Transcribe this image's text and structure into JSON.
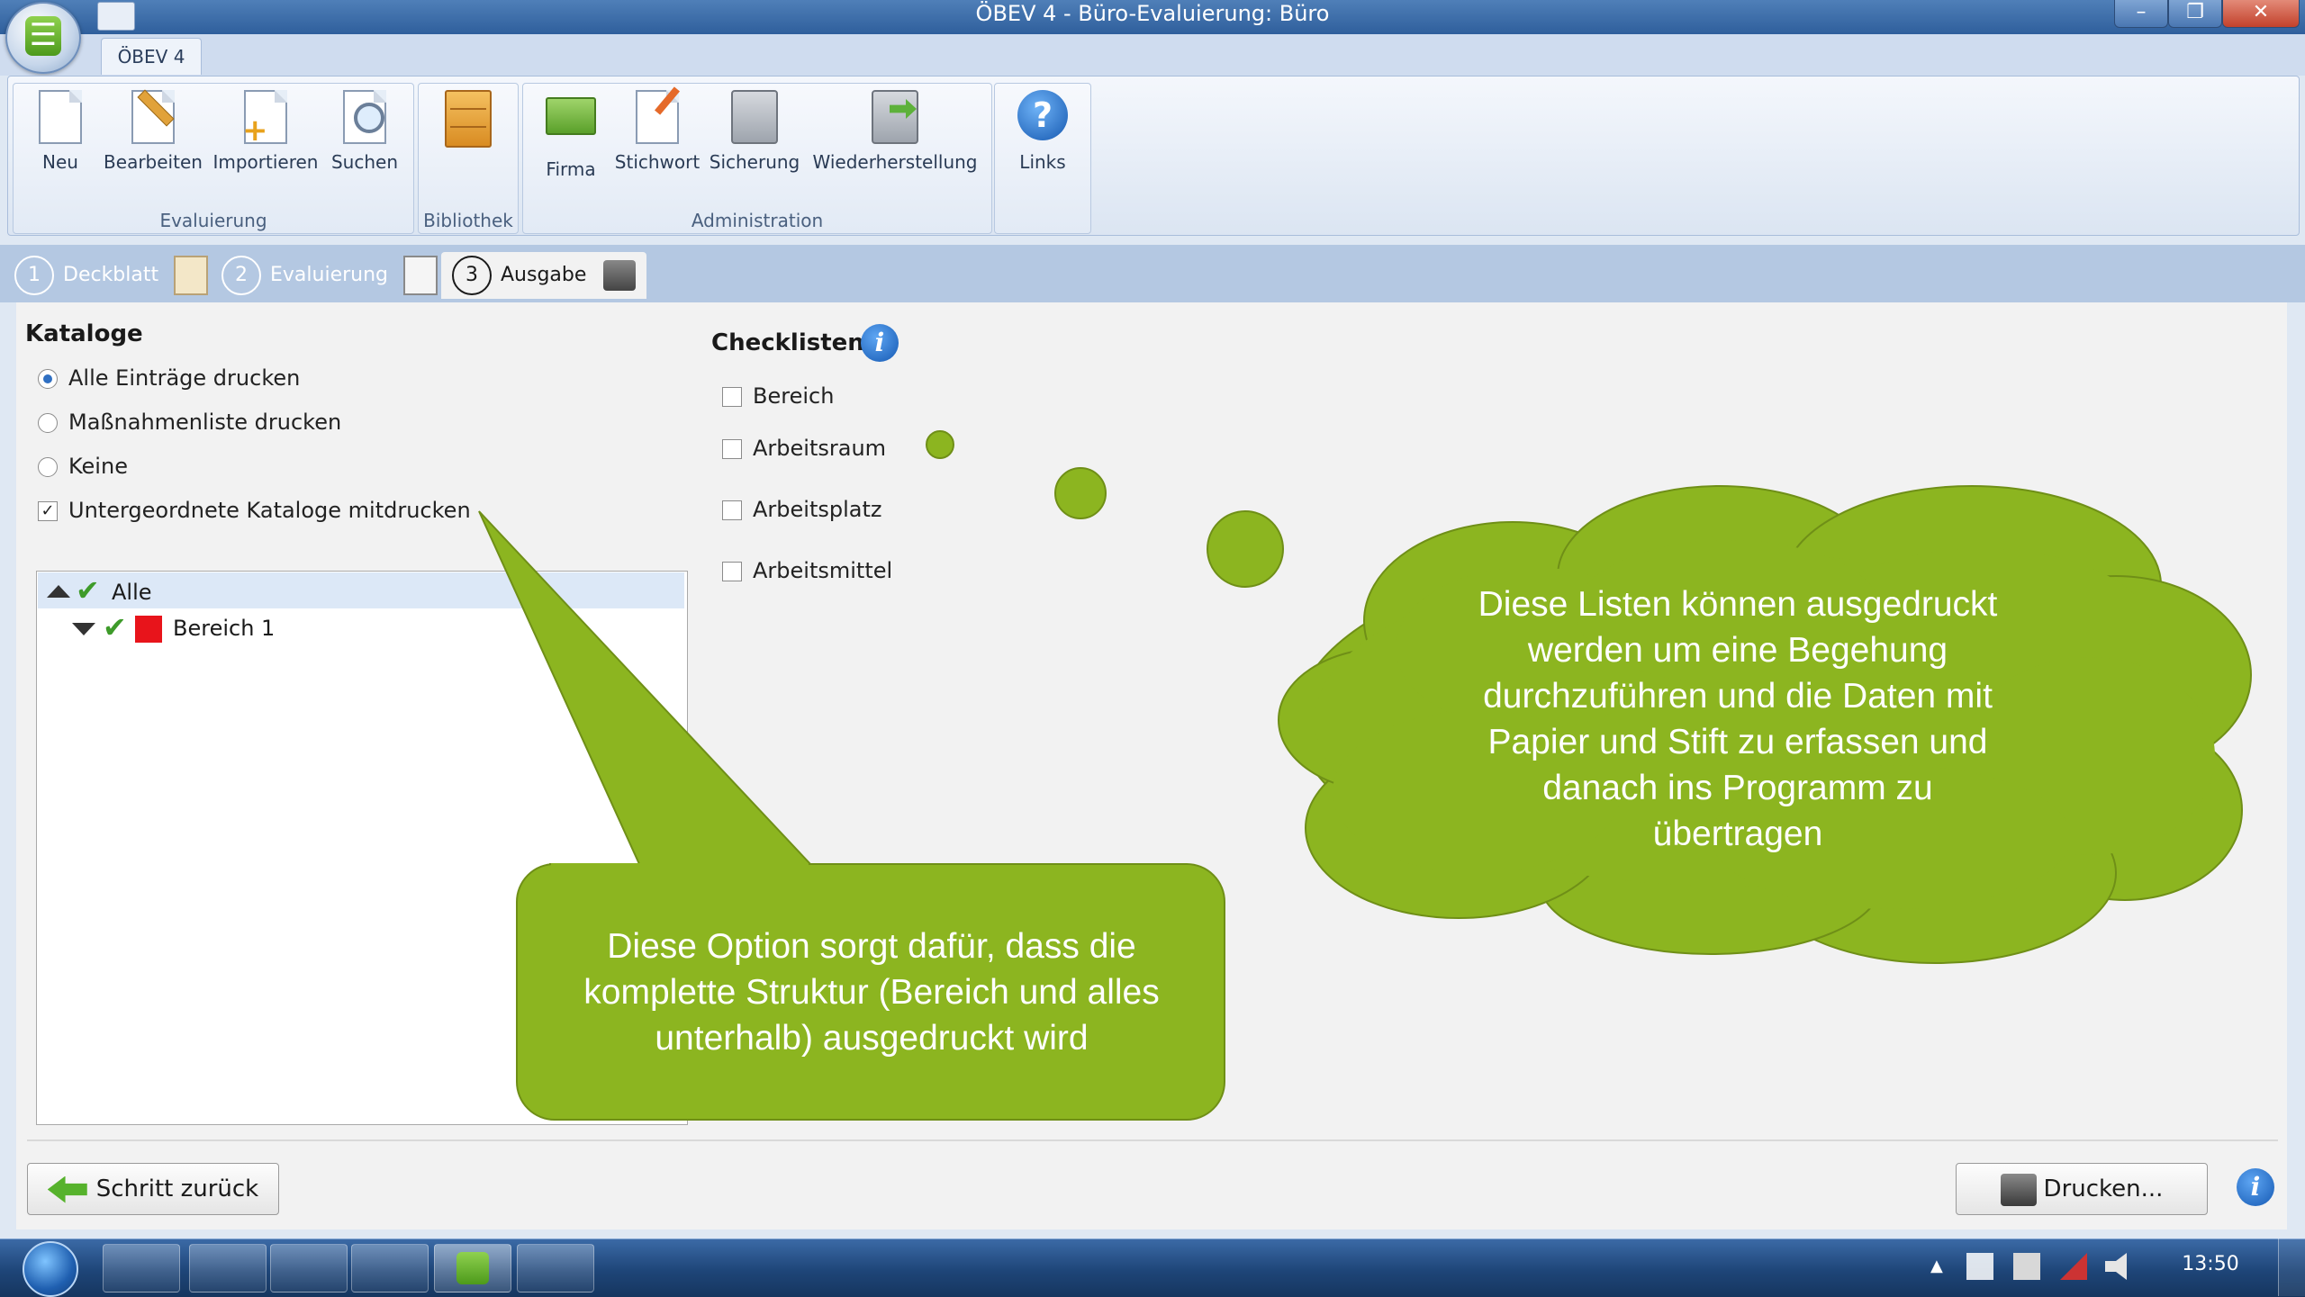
{
  "window": {
    "title": "ÖBEV 4 - Büro-Evaluierung: Büro",
    "minimize_glyph": "–",
    "restore_glyph": "❐",
    "close_glyph": "✕"
  },
  "ribbon": {
    "tab": "ÖBEV 4",
    "groups": {
      "evaluierung": "Evaluierung",
      "bibliothek": "Bibliothek",
      "administration": "Administration"
    },
    "buttons": {
      "neu": "Neu",
      "bearbeiten": "Bearbeiten",
      "importieren": "Importieren",
      "suchen": "Suchen",
      "firma": "Firma",
      "stichwort": "Stichwort",
      "sicherung": "Sicherung",
      "wiederherstellung": "Wiederherstellung",
      "links": "Links"
    }
  },
  "steps": [
    {
      "num": "1",
      "label": "Deckblatt"
    },
    {
      "num": "2",
      "label": "Evaluierung"
    },
    {
      "num": "3",
      "label": "Ausgabe"
    }
  ],
  "kataloge": {
    "title": "Kataloge",
    "options": {
      "alle": "Alle Einträge drucken",
      "massnahmen": "Maßnahmenliste drucken",
      "keine": "Keine"
    },
    "untergeordnete": "Untergeordnete Kataloge mitdrucken",
    "untergeordnete_checked": "✓",
    "tree": {
      "root": "Alle",
      "child": "Bereich 1"
    }
  },
  "checklisten": {
    "title": "Checklisten",
    "items": [
      "Bereich",
      "Arbeitsraum",
      "Arbeitsplatz",
      "Arbeitsmittel"
    ]
  },
  "callouts": {
    "speech": [
      "Diese Option sorgt dafür, dass die",
      "komplette Struktur (Bereich und alles",
      "unterhalb) ausgedruckt wird"
    ],
    "cloud": [
      "Diese Listen können ausgedruckt",
      "werden um eine Begehung",
      "durchzuführen und die Daten mit",
      "Papier und Stift zu erfassen und",
      "danach ins Programm zu",
      "übertragen"
    ]
  },
  "footer": {
    "back": "Schritt zurück",
    "print": "Drucken...",
    "info": "i"
  },
  "taskbar": {
    "clock": "13:50"
  },
  "colors": {
    "callout_green": "#8cb520",
    "callout_border": "#6f8f17",
    "check_green": "#3e9b2a",
    "bereich_red": "#e8141b",
    "info_blue": "#1d6fd1"
  }
}
